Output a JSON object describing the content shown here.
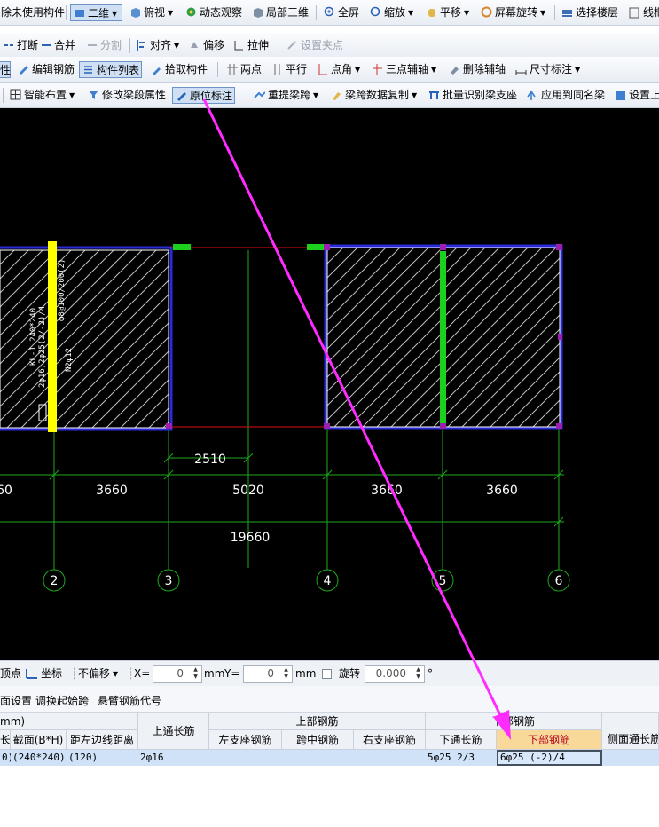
{
  "toolbar1": {
    "cut_label": "除未使用构件",
    "view_2d": "二维",
    "view_top": "俯视",
    "dynamic": "动态观察",
    "local3d": "局部三维",
    "fullscreen": "全屏",
    "zoom": "缩放",
    "pan": "平移",
    "rotate": "屏幕旋转",
    "select_floor": "选择楼层",
    "wireframe_cut": "线框"
  },
  "toolbar2": {
    "break": "打断",
    "merge": "合并",
    "split": "分割",
    "align": "对齐",
    "offset": "偏移",
    "stretch": "拉伸",
    "set_grip": "设置夹点"
  },
  "toolbar3": {
    "cut_label": "性",
    "edit_rebar": "编辑钢筋",
    "component_list": "构件列表",
    "pick": "拾取构件",
    "two_point": "两点",
    "parallel": "平行",
    "point_angle": "点角",
    "three_point_axis": "三点辅轴",
    "delete_axis": "删除辅轴",
    "dim": "尺寸标注"
  },
  "toolbar4": {
    "smart_layout": "智能布置",
    "modify_segment": "修改梁段属性",
    "in_situ": "原位标注",
    "re_extract": "重提梁跨",
    "copy_span": "梁跨数据复制",
    "batch_identify": "批量识别梁支座",
    "apply_same": "应用到同名梁",
    "set_cut": "设置上"
  },
  "drawing": {
    "dim_local": "2510",
    "spans": [
      "60",
      "3660",
      "5020",
      "3660",
      "3660"
    ],
    "total": "19660",
    "axes": [
      "2",
      "3",
      "4",
      "5",
      "6"
    ],
    "beam_label_1": "KL-1 240*240",
    "beam_label_2": "2φ16;2φ25(2/-2)/4",
    "beam_label_3": "N2φ12",
    "beam_label_4": "φ8@100/200(2)"
  },
  "statusbar": {
    "vertex": "顶点",
    "coord": "坐标",
    "no_offset": "不偏移",
    "x_label": "X=",
    "x_value": "0",
    "mm1": "mm",
    "y_label": "Y=",
    "y_value": "0",
    "mm2": "mm",
    "rotate": "旋转",
    "rotate_value": "0.000",
    "degree": "°"
  },
  "tabs": {
    "t1": "面设置",
    "t2": "调换起始跨",
    "t3": "悬臂钢筋代号"
  },
  "table": {
    "h_mm": "mm)",
    "h_len": "长",
    "h_section": "截面(B*H)",
    "h_left_dist": "距左边线距离",
    "h_top_long": "上通长筋",
    "h_top_group": "上部钢筋",
    "h_left_seat": "左支座钢筋",
    "h_mid": "跨中钢筋",
    "h_right_seat": "右支座钢筋",
    "h_bottom_group": "下部钢筋",
    "h_bottom_long": "下通长筋",
    "h_bottom_rebar": "下部钢筋",
    "h_side": "侧面通长筋",
    "row": {
      "c0": "0)",
      "c1": "(240*240)",
      "c2": "(120)",
      "c3": "2φ16",
      "c4": "",
      "c5": "",
      "c6": "",
      "c7": "5φ25 2/3",
      "c8": "6φ25 (-2)/4",
      "c9": ""
    }
  }
}
